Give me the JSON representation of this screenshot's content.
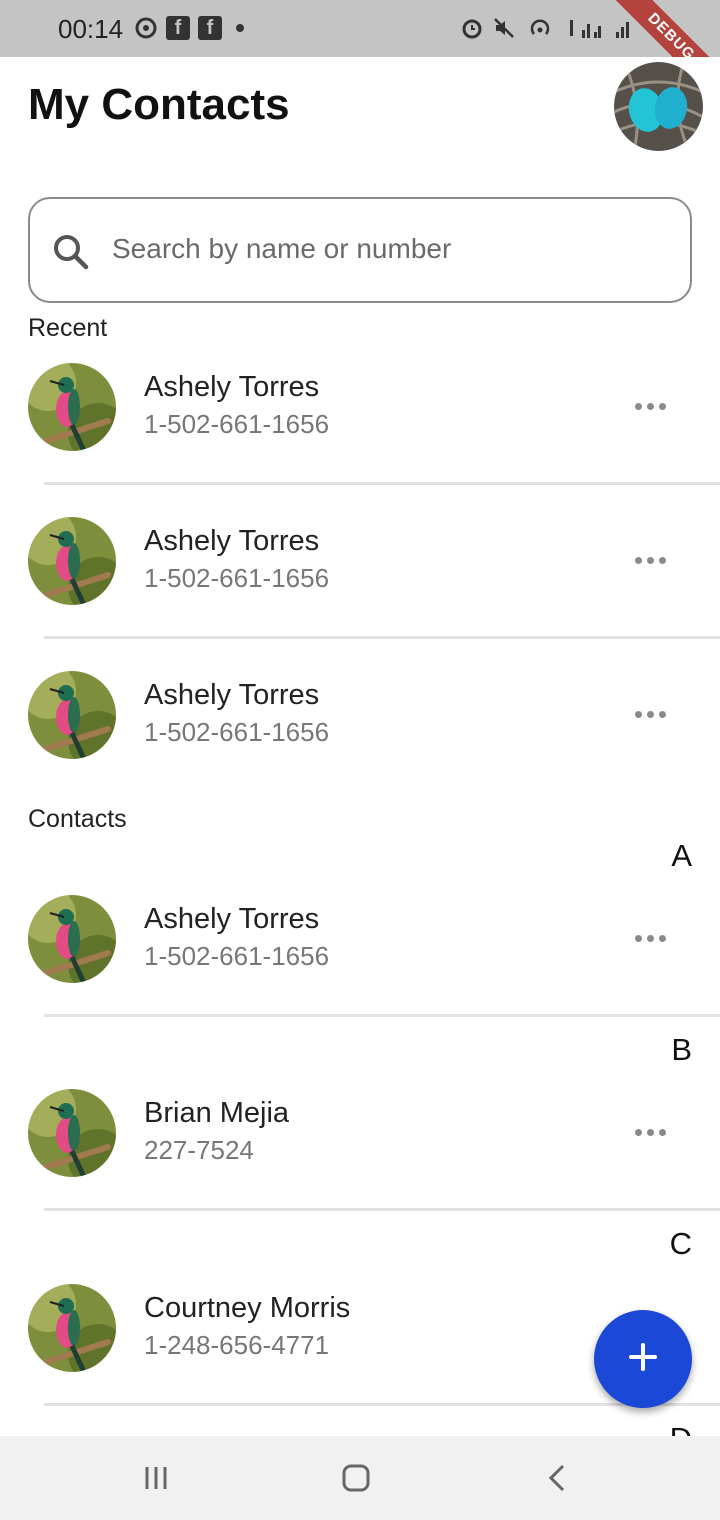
{
  "status_bar": {
    "time": "00:14",
    "debug_label": "DEBUG"
  },
  "header": {
    "title": "My Contacts"
  },
  "search": {
    "placeholder": "Search by name or number"
  },
  "sections": {
    "recent": "Recent",
    "contacts": "Contacts"
  },
  "recent": [
    {
      "name": "Ashely Torres",
      "phone": "1-502-661-1656"
    },
    {
      "name": "Ashely Torres",
      "phone": "1-502-661-1656"
    },
    {
      "name": "Ashely Torres",
      "phone": "1-502-661-1656"
    }
  ],
  "contacts": [
    {
      "letter": "A",
      "name": "Ashely Torres",
      "phone": "1-502-661-1656"
    },
    {
      "letter": "B",
      "name": "Brian Mejia",
      "phone": "227-7524"
    },
    {
      "letter": "C",
      "name": "Courtney Morris",
      "phone": "1-248-656-4771"
    }
  ],
  "next_letter": "D",
  "colors": {
    "accent": "#1b48d6",
    "status_bar": "#c4c4c4",
    "debug_ribbon": "#b5433d"
  },
  "icons": {
    "search": "search-icon",
    "more": "more-horizontal-icon",
    "add": "plus-icon",
    "nav_recents": "recents-icon",
    "nav_home": "home-icon",
    "nav_back": "back-icon"
  }
}
